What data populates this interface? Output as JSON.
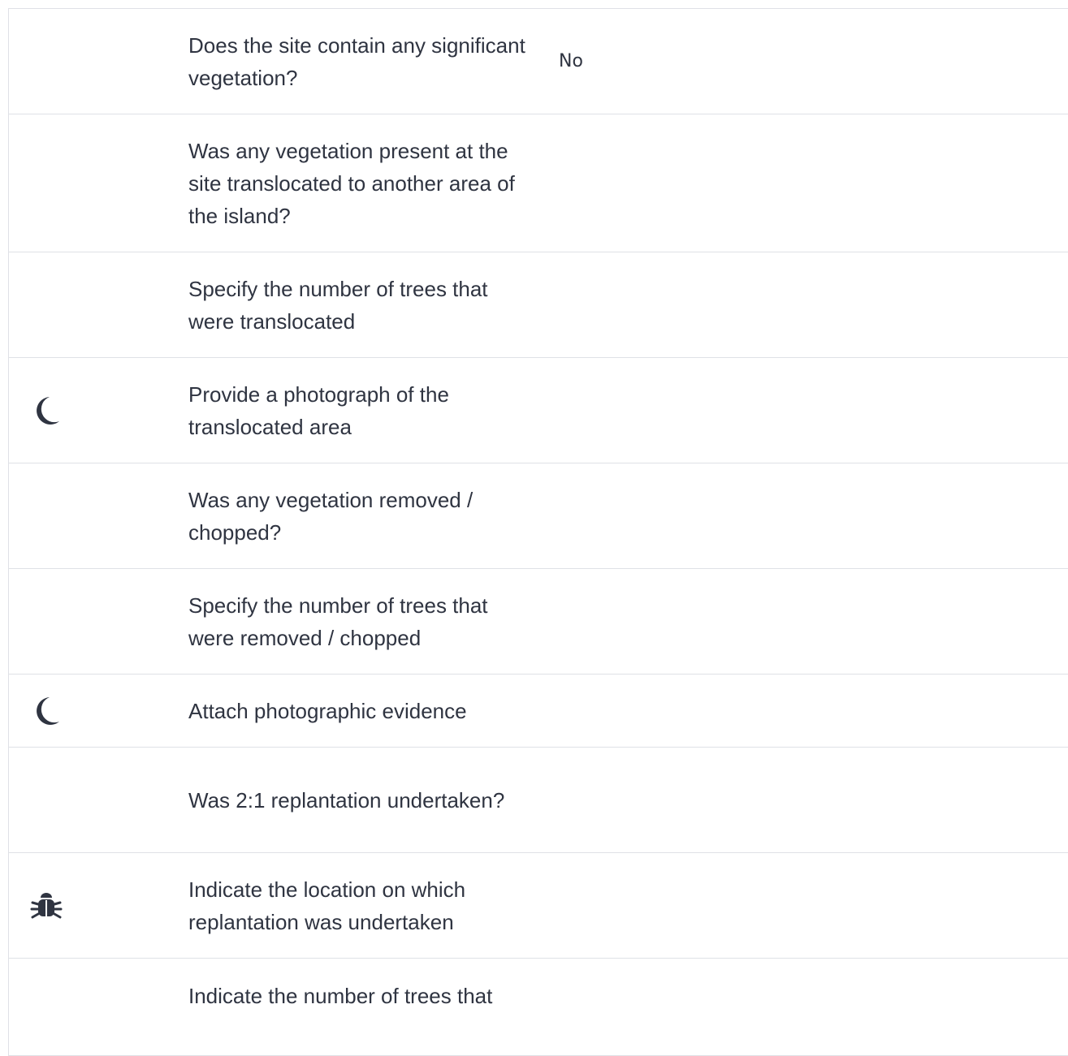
{
  "rows": [
    {
      "question": "Does the site contain any significant vegetation?",
      "answer": "No",
      "icon": ""
    },
    {
      "question": "Was any vegetation present at the site translocated to another area of the island?",
      "answer": "",
      "icon": ""
    },
    {
      "question": "Specify the number of trees that were translocated",
      "answer": "",
      "icon": ""
    },
    {
      "question": "Provide a photograph of the translocated area",
      "answer": "",
      "icon": "moon-icon"
    },
    {
      "question": "Was any vegetation removed / chopped?",
      "answer": "",
      "icon": ""
    },
    {
      "question": "Specify the number of trees that were removed / chopped",
      "answer": "",
      "icon": ""
    },
    {
      "question": "Attach photographic evidence",
      "answer": "",
      "icon": "moon-icon"
    },
    {
      "question": "Was 2:1 replantation undertaken?",
      "answer": "",
      "icon": ""
    },
    {
      "question": "Indicate the location on which replantation was undertaken",
      "answer": "",
      "icon": "bug-icon"
    },
    {
      "question": "Indicate the number of trees that",
      "answer": "",
      "icon": ""
    }
  ],
  "colors": {
    "text": "#2f3441",
    "border": "#dfe1e6",
    "icon": "#2f3441"
  }
}
